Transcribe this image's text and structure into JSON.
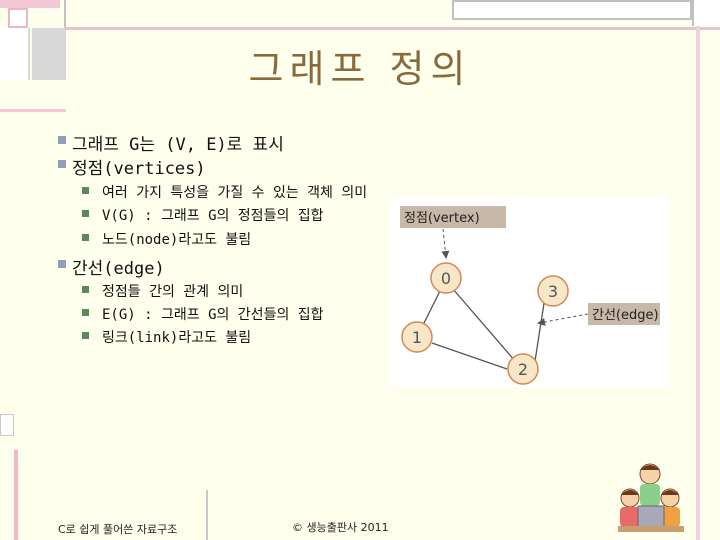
{
  "slide": {
    "title": "그래프 정의",
    "bullets": [
      {
        "level": 1,
        "text": "그래프 G는 (V, E)로 표시"
      },
      {
        "level": 1,
        "text": "정점(vertices)"
      },
      {
        "level": 2,
        "text": "여러 가지 특성을 가질 수 있는 객체 의미"
      },
      {
        "level": 2,
        "text": "V(G) : 그래프 G의 정점들의 집합"
      },
      {
        "level": 2,
        "text": "노드(node)라고도 불림"
      },
      {
        "level": 1,
        "text": "간선(edge)"
      },
      {
        "level": 2,
        "text": "정점들 간의 관계 의미"
      },
      {
        "level": 2,
        "text": "E(G) : 그래프 G의 간선들의 집합"
      },
      {
        "level": 2,
        "text": "링크(link)라고도 불림"
      }
    ],
    "footer_left": "C로 쉽게 풀어쓴 자료구조",
    "footer_center": "© 생능출판사 2011"
  },
  "graph_figure": {
    "vertex_label": "정점(vertex)",
    "edge_label": "간선(edge)",
    "nodes": [
      "0",
      "1",
      "2",
      "3"
    ],
    "edges": [
      [
        "0",
        "1"
      ],
      [
        "0",
        "2"
      ],
      [
        "1",
        "2"
      ],
      [
        "2",
        "3"
      ]
    ]
  },
  "colors": {
    "background": "#ffffee",
    "title": "#8a6a3a",
    "node_fill": "#f8e6c8",
    "node_stroke": "#d08a52",
    "label_box": "#c8b8a8"
  }
}
